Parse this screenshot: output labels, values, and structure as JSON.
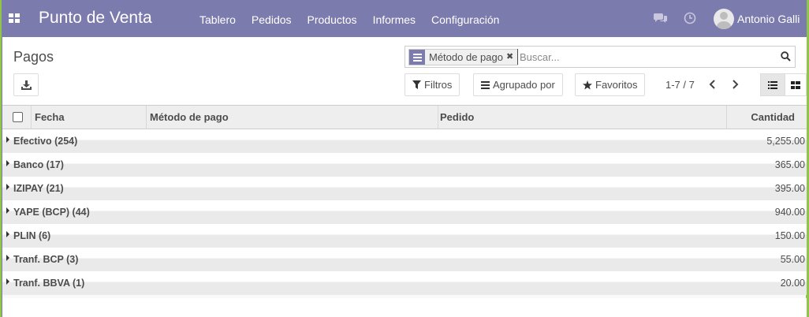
{
  "navbar": {
    "brand": "Punto de Venta",
    "menu": [
      "Tablero",
      "Pedidos",
      "Productos",
      "Informes",
      "Configuración"
    ],
    "user_name": "Antonio Galli",
    "icons": [
      "apps-icon",
      "chat-icon",
      "clock-icon"
    ],
    "color": "#7c7bad"
  },
  "control_panel": {
    "breadcrumb": "Pagos",
    "search": {
      "facet_value": "Método de pago",
      "placeholder": "Buscar..."
    },
    "filters_label": "Filtros",
    "groupby_label": "Agrupado por",
    "favorites_label": "Favoritos",
    "pager": "1-7 / 7"
  },
  "table": {
    "headers": {
      "fecha": "Fecha",
      "metodo": "Método de pago",
      "pedido": "Pedido",
      "cantidad": "Cantidad"
    },
    "groups": [
      {
        "label": "Efectivo (254)",
        "amount": "5,255.00"
      },
      {
        "label": "Banco (17)",
        "amount": "365.00"
      },
      {
        "label": "IZIPAY (21)",
        "amount": "395.00"
      },
      {
        "label": "YAPE (BCP) (44)",
        "amount": "940.00"
      },
      {
        "label": "PLIN (6)",
        "amount": "150.00"
      },
      {
        "label": "Tranf. BCP (3)",
        "amount": "55.00"
      },
      {
        "label": "Tranf. BBVA (1)",
        "amount": "20.00"
      }
    ]
  }
}
